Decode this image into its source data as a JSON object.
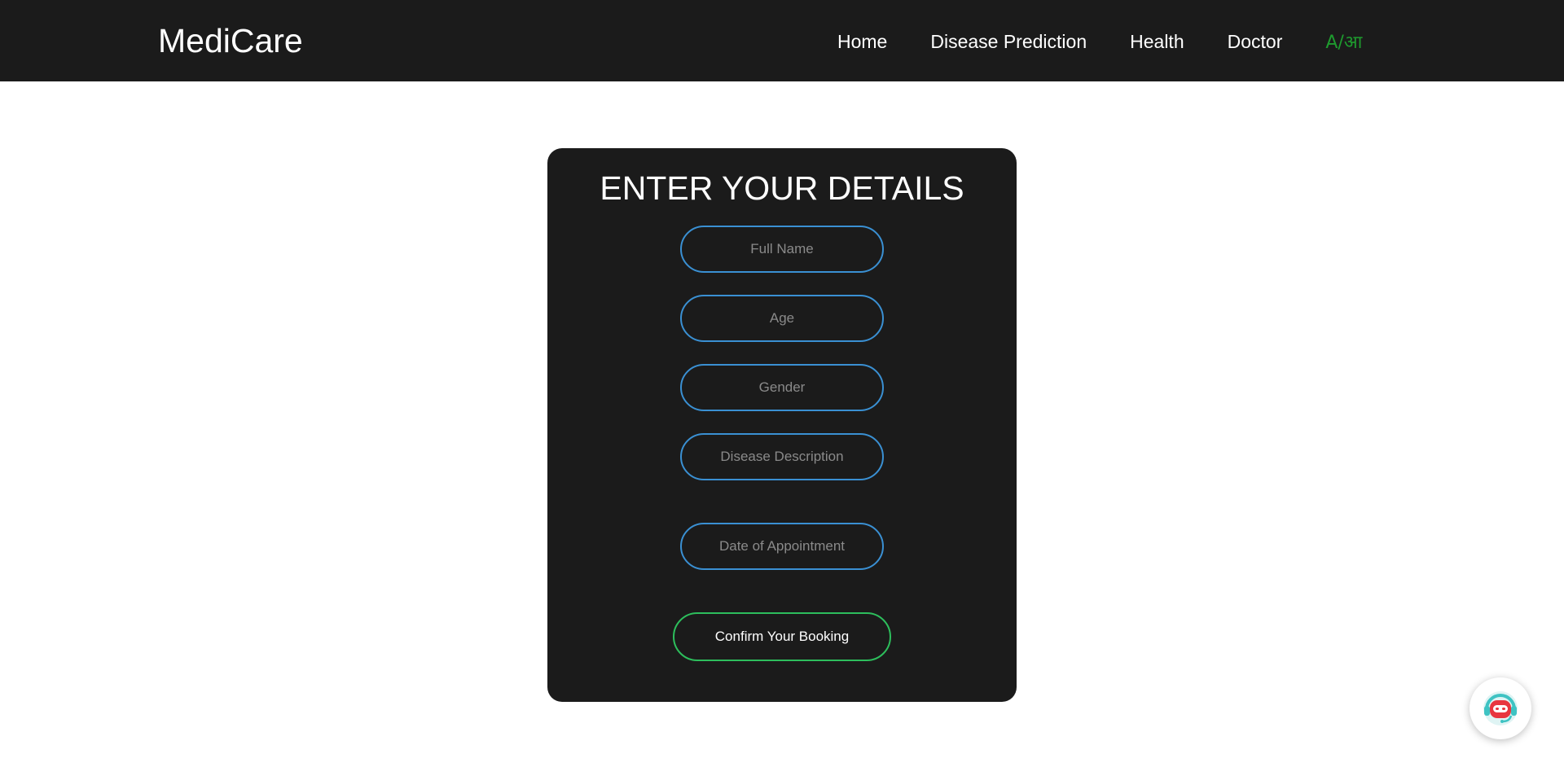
{
  "header": {
    "brand": "MediCare",
    "nav": [
      {
        "label": "Home"
      },
      {
        "label": "Disease Prediction"
      },
      {
        "label": "Health"
      },
      {
        "label": "Doctor"
      },
      {
        "label": "A/आ"
      }
    ]
  },
  "form": {
    "title": "ENTER YOUR DETAILS",
    "fields": {
      "full_name": {
        "placeholder": "Full Name",
        "value": ""
      },
      "age": {
        "placeholder": "Age",
        "value": ""
      },
      "gender": {
        "placeholder": "Gender",
        "value": ""
      },
      "disease_description": {
        "placeholder": "Disease Description",
        "value": ""
      },
      "date_of_appointment": {
        "placeholder": "Date of Appointment",
        "value": ""
      }
    },
    "submit_label": "Confirm Your Booking"
  },
  "chatbot": {
    "icon": "robot-chat-icon"
  },
  "colors": {
    "header_bg": "#1b1b1b",
    "card_bg": "#1b1b1b",
    "field_border": "#3a90d3",
    "button_border": "#2dbe5c",
    "language_toggle": "#1e9b2e"
  }
}
